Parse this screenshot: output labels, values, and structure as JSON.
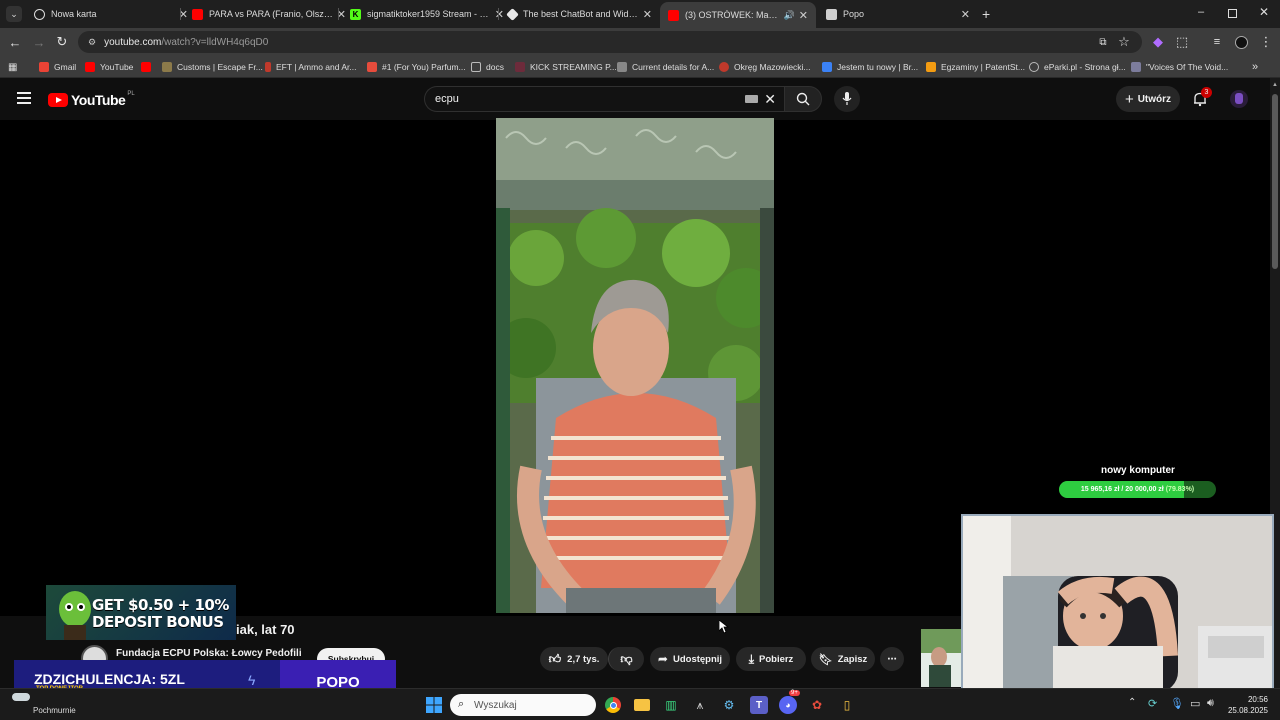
{
  "browser": {
    "tabs": [
      {
        "label": "Nowa karta",
        "favicon_color": "#e8e8e8"
      },
      {
        "label": "PARA vs PARA (Franio, Olsza, M",
        "favicon_color": "#ff0000"
      },
      {
        "label": "sigmatiktoker1959 Stream - Wa",
        "favicon_color": "#53fc18"
      },
      {
        "label": "The best ChatBot and Widgets",
        "favicon_color": "#e8e8e8"
      },
      {
        "label": "(3) OSTRÓWEK: Marek Grze",
        "favicon_color": "#ff0000"
      },
      {
        "label": "Popo",
        "favicon_color": "#e8e8e8"
      }
    ],
    "url_host": "youtube.com",
    "url_rest": "/watch?v=lldWH4q6qD0",
    "bookmarks": [
      {
        "label": "Gmail",
        "color": "#ea4335"
      },
      {
        "label": "YouTube",
        "color": "#ff0000"
      },
      {
        "label": "",
        "color": "#ff0000"
      },
      {
        "label": "Customs | Escape Fr...",
        "color": "#8c7a4a"
      },
      {
        "label": "EFT | Ammo and Ar...",
        "color": "#c0392b"
      },
      {
        "label": "#1 (For You) Parfum...",
        "color": "#e74c3c"
      },
      {
        "label": "docs",
        "color": "#9e9e9e"
      },
      {
        "label": "KICK STREAMING P...",
        "color": "#6d2b3b"
      },
      {
        "label": "Current details for A...",
        "color": "#888888"
      },
      {
        "label": "Okręg Mazowiecki...",
        "color": "#c0392b"
      },
      {
        "label": "Jestem tu nowy | Br...",
        "color": "#3b82f6"
      },
      {
        "label": "Egzaminy | PatentSt...",
        "color": "#f39c12"
      },
      {
        "label": "eParki.pl - Strona gł...",
        "color": "#9e9e9e"
      },
      {
        "label": "\"Voices Of The Void...",
        "color": "#7c7c9c"
      }
    ]
  },
  "youtube": {
    "logo": "YouTube",
    "country": "PL",
    "search_value": "ecpu",
    "create_label": "Utwórz",
    "notification_count": "3",
    "title_rest": "iak, lat 70",
    "channel_name": "Fundacja ECPU Polska: Łowcy Pedofili",
    "subscribe_label": "Subskrybuj",
    "likes": "2,7 tys.",
    "share_label": "Udostępnij",
    "download_label": "Pobierz",
    "save_label": "Zapisz"
  },
  "overlay": {
    "ad_line1": "GET $0.50 + 10%",
    "ad_line2": "DEPOSIT BONUS",
    "donor_text": "ZDZICHULENCJA: 5ZL",
    "donor_sub": "TOP DONEJTOR",
    "donor_name": "POPO",
    "goal_title": "nowy komputer",
    "goal_text": "15 965,16 zł / 20 000,00 zł",
    "goal_percent_text": "(79.83%)",
    "goal_fraction": 0.7983
  },
  "taskbar": {
    "weather": "Pochmurnie",
    "search_placeholder": "Wyszukaj",
    "time": "20:56",
    "date": "25.08.2025",
    "discord_badge": "9+"
  },
  "colors": {
    "yt_red": "#ff0000",
    "goal_green": "#2ecc40",
    "donor_blue": "#1d1d7e",
    "donor_purple": "#3a1fb3"
  }
}
